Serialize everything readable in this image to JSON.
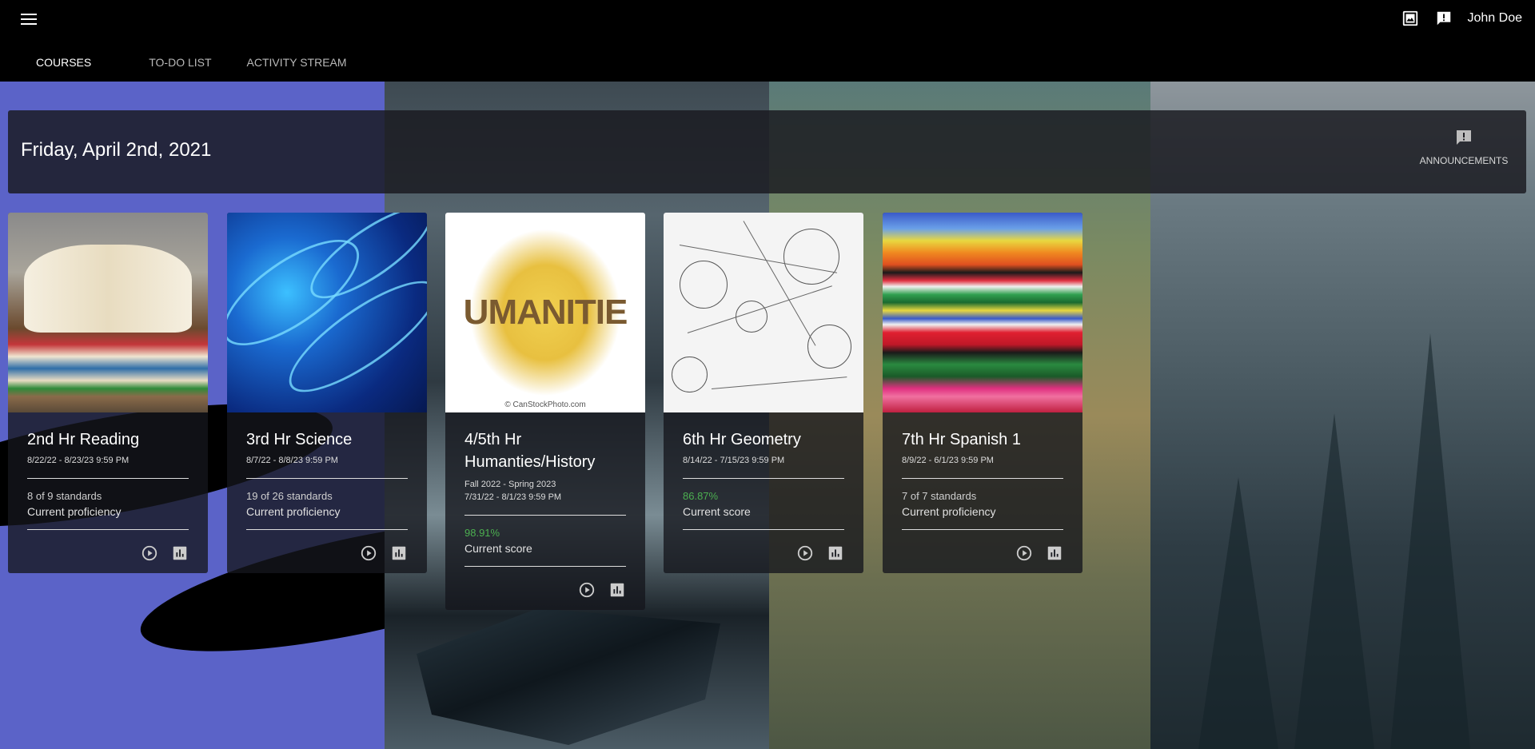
{
  "header": {
    "user_name": "John Doe",
    "tabs": [
      {
        "label": "COURSES"
      },
      {
        "label": "TO-DO LIST"
      },
      {
        "label": "ACTIVITY STREAM"
      }
    ]
  },
  "banner": {
    "date": "Friday, April 2nd, 2021",
    "announcements_label": "ANNOUNCEMENTS"
  },
  "courses": [
    {
      "title": "2nd Hr Reading",
      "dates": "8/22/22 - 8/23/23 9:59 PM",
      "term": "",
      "stat_value": "8 of 9 standards",
      "stat_label": "Current proficiency"
    },
    {
      "title": "3rd Hr Science",
      "dates": "8/7/22 - 8/8/23 9:59 PM",
      "term": "",
      "stat_value": "19 of 26 standards",
      "stat_label": "Current proficiency"
    },
    {
      "title": "4/5th Hr Humanties/History",
      "term": "Fall 2022 - Spring 2023",
      "dates": "7/31/22 - 8/1/23 9:59 PM",
      "stat_value": "98.91%",
      "stat_label": "Current score"
    },
    {
      "title": "6th Hr Geometry",
      "dates": "8/14/22 - 7/15/23 9:59 PM",
      "term": "",
      "stat_value": "86.87%",
      "stat_label": "Current score"
    },
    {
      "title": "7th Hr Spanish 1",
      "dates": "8/9/22 - 6/1/23 9:59 PM",
      "term": "",
      "stat_value": "7 of 7 standards",
      "stat_label": "Current proficiency"
    }
  ],
  "thumbnails": {
    "humanities_word": "UMANITIE",
    "humanities_credit": "© CanStockPhoto.com"
  },
  "icons": [
    "menu-icon",
    "wallpaper-icon",
    "alert-icon",
    "announcement-icon",
    "play-circle-icon",
    "bar-chart-icon"
  ],
  "colors": {
    "score_green": "#4caf50",
    "topbar": "#000000"
  }
}
